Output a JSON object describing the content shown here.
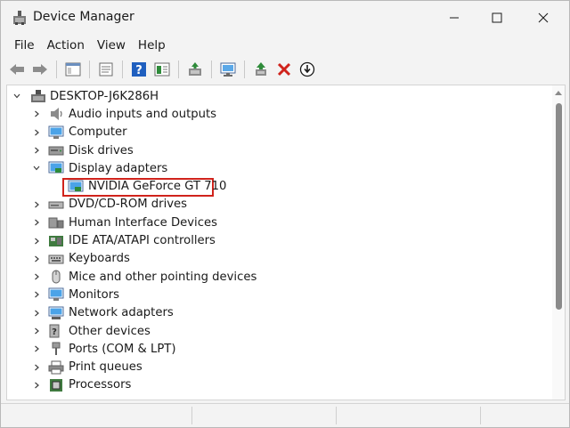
{
  "window": {
    "title": "Device Manager",
    "icon": "device-manager-icon"
  },
  "menu": {
    "items": [
      "File",
      "Action",
      "View",
      "Help"
    ]
  },
  "toolbar": {
    "icons": [
      "back-arrow-icon",
      "forward-arrow-icon",
      "show-hide-console-tree-icon",
      "properties-icon",
      "help-icon",
      "export-list-icon",
      "update-driver-icon",
      "scan-hardware-icon",
      "enable-device-icon",
      "uninstall-device-icon",
      "download-update-icon"
    ]
  },
  "tree": {
    "root": "DESKTOP-J6K286H",
    "categories": [
      {
        "label": "Audio inputs and outputs",
        "icon": "speaker-icon",
        "expanded": false
      },
      {
        "label": "Computer",
        "icon": "computer-icon",
        "expanded": false
      },
      {
        "label": "Disk drives",
        "icon": "disk-drive-icon",
        "expanded": false
      },
      {
        "label": "Display adapters",
        "icon": "display-adapter-icon",
        "expanded": true
      },
      {
        "label": "DVD/CD-ROM drives",
        "icon": "dvd-drive-icon",
        "expanded": false
      },
      {
        "label": "Human Interface Devices",
        "icon": "hid-icon",
        "expanded": false
      },
      {
        "label": "IDE ATA/ATAPI controllers",
        "icon": "ide-controller-icon",
        "expanded": false
      },
      {
        "label": "Keyboards",
        "icon": "keyboard-icon",
        "expanded": false
      },
      {
        "label": "Mice and other pointing devices",
        "icon": "mouse-icon",
        "expanded": false
      },
      {
        "label": "Monitors",
        "icon": "monitor-icon",
        "expanded": false
      },
      {
        "label": "Network adapters",
        "icon": "network-adapter-icon",
        "expanded": false
      },
      {
        "label": "Other devices",
        "icon": "other-devices-icon",
        "expanded": false
      },
      {
        "label": "Ports (COM & LPT)",
        "icon": "port-icon",
        "expanded": false
      },
      {
        "label": "Print queues",
        "icon": "printer-icon",
        "expanded": false
      },
      {
        "label": "Processors",
        "icon": "processor-icon",
        "expanded": false
      }
    ],
    "display_child": "NVIDIA GeForce GT 710"
  },
  "colors": {
    "highlight_border": "#d0231c",
    "uninstall_red": "#d0231c",
    "help_blue": "#1f5fbf",
    "update_green": "#2e8b3a"
  }
}
